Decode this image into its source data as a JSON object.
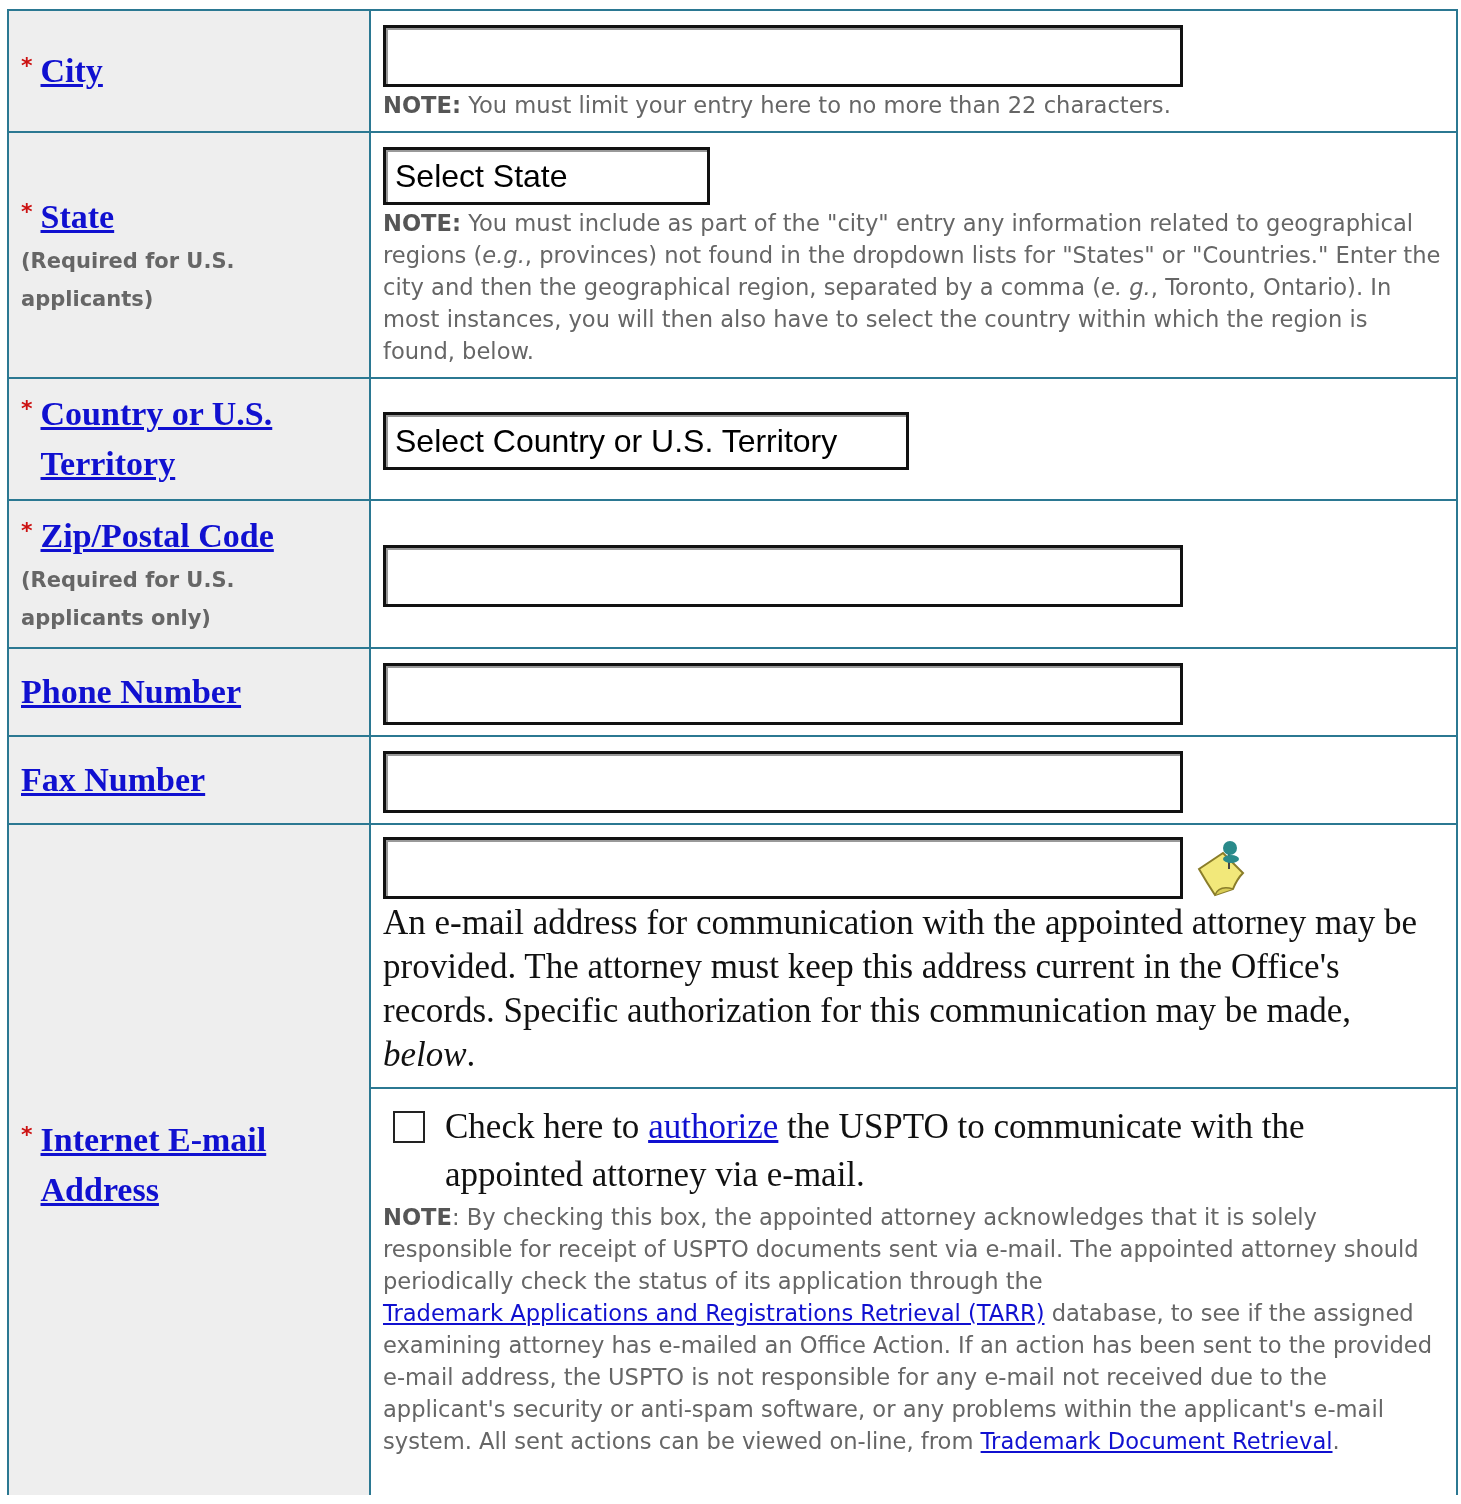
{
  "rows": [
    {
      "kind": "text",
      "marker": "*",
      "label": "City",
      "note": [
        {
          "kind": "text",
          "text": "**NOTE:** You must limit your entry here to no more than 22 characters."
        }
      ]
    },
    {
      "kind": "select",
      "marker": "*",
      "label": "State",
      "sublabel": "(Required for U.S. applicants)",
      "value": "Select State",
      "note": [
        {
          "kind": "text",
          "text": "**NOTE:** You must include as part of the \"city\" entry any information related to geographical regions (*e.g.*, provinces) not found in the dropdown lists for \"States\" or \"Countries.\" Enter the city and then the geographical region, separated by a comma (*e. g.*, Toronto, Ontario). In most instances, you will then also have to select the country within which the region is found, below."
        }
      ]
    },
    {
      "kind": "select",
      "marker": "*",
      "label": "Country or U.S. Territory",
      "value": "Select Country or U.S. Territory"
    },
    {
      "kind": "text",
      "marker": "*",
      "label": "Zip/Postal Code",
      "sublabel": "(Required for U.S. applicants only)"
    },
    {
      "kind": "text",
      "label": "Phone Number"
    },
    {
      "kind": "text",
      "label": "Fax Number"
    },
    {
      "kind": "email",
      "marker": "*",
      "label": "Internet E-mail Address",
      "help": "An e-mail address for communication with the appointed attorney may be provided. The attorney must keep this address current in the Office's records. Specific authorization for this communication may be made, *below*.",
      "authorize": {
        "checked": false,
        "text": [
          {
            "kind": "text",
            "text": "Check here to "
          },
          {
            "kind": "link",
            "text": "authorize"
          },
          {
            "kind": "text",
            "text": " the USPTO to communicate with the appointed attorney via e-mail."
          }
        ]
      },
      "note": [
        {
          "kind": "text",
          "text": "**NOTE**: By checking this box, the appointed attorney acknowledges that it is solely responsible for receipt of USPTO documents sent via e-mail. The appointed attorney should periodically check the status of its application through the "
        },
        {
          "kind": "link",
          "text": "Trademark Applications and Registrations Retrieval (TARR)"
        },
        {
          "kind": "text",
          "text": " database, to see if the assigned examining attorney has e-mailed an Office Action. If an action has been sent to the provided e-mail address, the USPTO is not responsible for any e-mail not received due to the applicant's security or anti-spam software, or any problems within the applicant's e-mail system. All sent actions can be viewed on-line, from "
        },
        {
          "kind": "link",
          "text": "Trademark Document Retrieval"
        },
        {
          "kind": "text",
          "text": "."
        }
      ]
    }
  ]
}
